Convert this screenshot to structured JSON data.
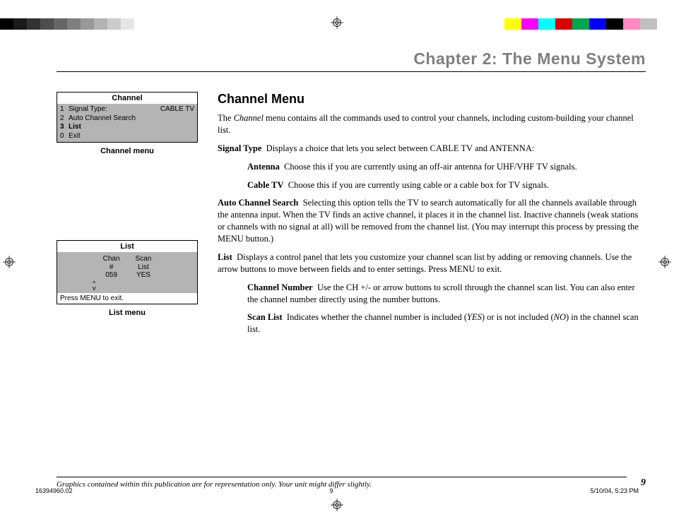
{
  "registration_colors_left": [
    "#000000",
    "#1a1a1a",
    "#333333",
    "#4d4d4d",
    "#666666",
    "#808080",
    "#999999",
    "#b3b3b3",
    "#cccccc",
    "#e6e6e6",
    "#ffffff"
  ],
  "registration_colors_right": [
    "#ffff00",
    "#ff00ff",
    "#00ffff",
    "#d90000",
    "#00a650",
    "#0000ff",
    "#000000",
    "#ff8ac0",
    "#c0c0c0",
    "#ffffff"
  ],
  "chapter_title": "Chapter 2: The Menu System",
  "section_title": "Channel Menu",
  "intro_1a": "The ",
  "intro_1b": "Channel",
  "intro_1c": " menu contains all the commands used to control your channels, including custom-building your channel list.",
  "signal_type": {
    "term": "Signal Type",
    "desc": "Displays a choice that lets you select between CABLE TV and ANTENNA:",
    "antenna_term": "Antenna",
    "antenna_desc": "Choose this if you are currently using an off-air antenna for UHF/VHF TV signals.",
    "cable_term": "Cable TV",
    "cable_desc": "Choose this if you are currently using cable or a cable box for TV signals."
  },
  "auto_search": {
    "term": "Auto Channel Search",
    "desc": "Selecting this option tells the TV to search automatically for all the channels available through the antenna input. When the TV finds an active channel, it places it in the channel list.  Inactive channels (weak stations or channels with no signal at all) will be removed from the channel list. (You may interrupt this process by pressing the MENU button.)"
  },
  "list": {
    "term": "List",
    "desc": "Displays a control panel that lets you customize your channel scan list by adding or removing channels. Use the arrow buttons to move between fields and to enter settings. Press MENU to exit.",
    "chnum_term": "Channel Number",
    "chnum_desc": "Use the CH +/-  or arrow buttons to scroll through the channel scan list. You can also enter the channel number directly using the number buttons.",
    "scan_term": "Scan List",
    "scan_desc_a": "Indicates whether the channel number is included (",
    "scan_desc_yes": "YES",
    "scan_desc_b": ") or is not included (",
    "scan_desc_no": "NO",
    "scan_desc_c": ") in the channel scan list."
  },
  "channel_menu": {
    "title": "Channel",
    "rows": [
      {
        "num": "1",
        "label": "Signal Type:",
        "value": "CABLE TV",
        "bold": false
      },
      {
        "num": "2",
        "label": "Auto Channel Search",
        "value": "",
        "bold": false
      },
      {
        "num": "3",
        "label": "List",
        "value": "",
        "bold": true
      },
      {
        "num": "0",
        "label": "Exit",
        "value": "",
        "bold": false
      }
    ],
    "caption": "Channel menu"
  },
  "list_menu": {
    "title": "List",
    "col1_h1": "Chan",
    "col1_h2": "#",
    "col1_val": "059",
    "col2_h1": "Scan",
    "col2_h2": "List",
    "col2_val": "YES",
    "arrow_up": "^",
    "arrow_dn": "v",
    "footer": "Press MENU to exit.",
    "caption": "List menu"
  },
  "footer_note": "Graphics contained within this publication are for representation only. Your unit might differ slightly.",
  "page_number": "9",
  "meta": {
    "doc_id": "16394960.02",
    "page": "9",
    "timestamp": "5/10/04, 5:23 PM"
  }
}
